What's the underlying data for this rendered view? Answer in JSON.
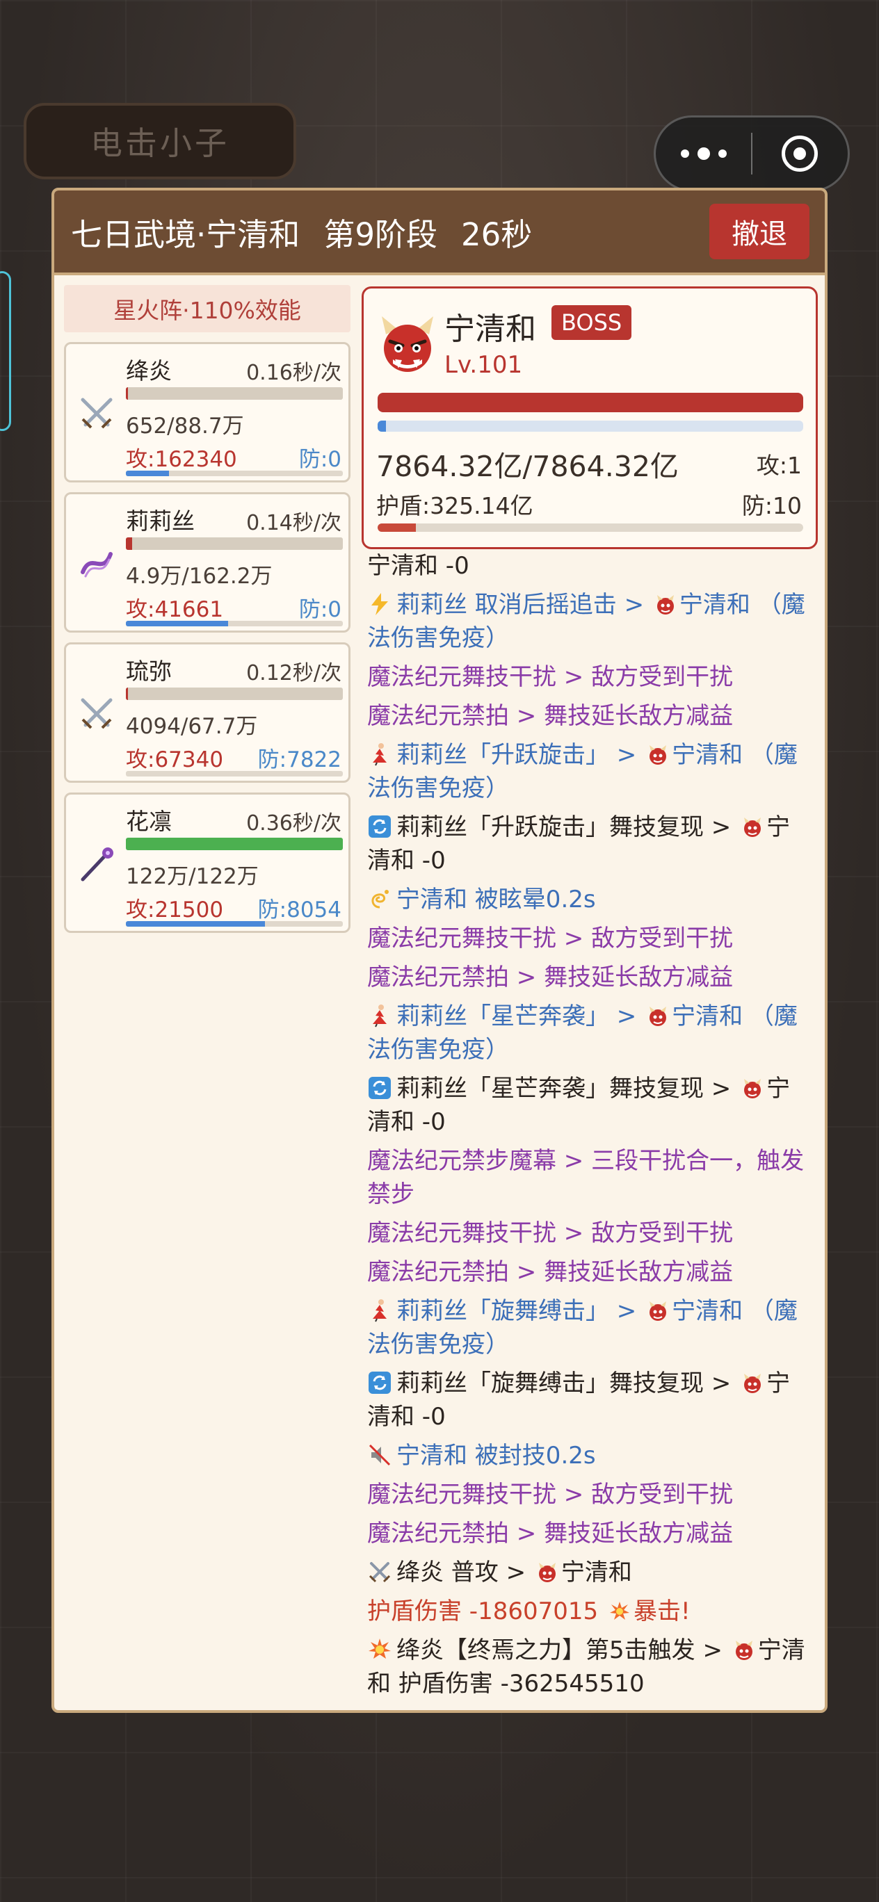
{
  "game": {
    "title": "电击小子"
  },
  "dialog": {
    "title_name": "七日武境·宁清和",
    "stage": "第9阶段",
    "timer": "26秒",
    "retreat_label": "撤退"
  },
  "formation": {
    "label": "星火阵·110%效能"
  },
  "heroes": [
    {
      "name": "绛炎",
      "speed": "0.16秒/次",
      "hp": "652/88.7万",
      "atk": "攻:162340",
      "def": "防:0",
      "hp_fraction": 0.01,
      "mp_fraction": 0.2,
      "icon": "crossed-swords-icon"
    },
    {
      "name": "莉莉丝",
      "speed": "0.14秒/次",
      "hp": "4.9万/162.2万",
      "atk": "攻:41661",
      "def": "防:0",
      "hp_fraction": 0.03,
      "mp_fraction": 0.47,
      "icon": "ribbon-icon"
    },
    {
      "name": "琉弥",
      "speed": "0.12秒/次",
      "hp": "4094/67.7万",
      "atk": "攻:67340",
      "def": "防:7822",
      "hp_fraction": 0.01,
      "mp_fraction": 0.0,
      "icon": "crossed-swords-icon"
    },
    {
      "name": "花凛",
      "speed": "0.36秒/次",
      "hp": "122万/122万",
      "atk": "攻:21500",
      "def": "防:8054",
      "hp_fraction": 1.0,
      "mp_fraction": 0.64,
      "icon": "staff-icon"
    }
  ],
  "boss": {
    "name": "宁清和",
    "tag": "BOSS",
    "level": "Lv.101",
    "hp": "7864.32亿/7864.32亿",
    "atk": "攻:1",
    "shield": "护盾:325.14亿",
    "def": "防:10",
    "hp_fraction": 1.0,
    "mp_fraction": 0.02,
    "shield_fraction": 0.09
  },
  "log": [
    {
      "color": "black",
      "text": "宁清和 -0"
    },
    {
      "color": "blue",
      "icon": "lightning-icon",
      "text": "莉莉丝 取消后摇追击 > ",
      "target": "宁清和 （魔法伤害免疫）"
    },
    {
      "color": "purple",
      "text": "魔法纪元舞技干扰 > 敌方受到干扰"
    },
    {
      "color": "purple",
      "text": "魔法纪元禁拍 > 舞技延长敌方减益"
    },
    {
      "color": "blue",
      "icon": "dancer-icon",
      "text": "莉莉丝「升跃旋击」 > ",
      "target": "宁清和 （魔法伤害免疫）"
    },
    {
      "color": "black",
      "icon": "repeat-icon",
      "text": "莉莉丝「升跃旋击」舞技复现 > ",
      "target": "宁清和 -0"
    },
    {
      "color": "blue",
      "icon": "dizzy-icon",
      "text": "宁清和 被眩晕0.2s"
    },
    {
      "color": "purple",
      "text": "魔法纪元舞技干扰 > 敌方受到干扰"
    },
    {
      "color": "purple",
      "text": "魔法纪元禁拍 > 舞技延长敌方减益"
    },
    {
      "color": "blue",
      "icon": "dancer-icon",
      "text": "莉莉丝「星芒奔袭」 > ",
      "target": "宁清和 （魔法伤害免疫）"
    },
    {
      "color": "black",
      "icon": "repeat-icon",
      "text": "莉莉丝「星芒奔袭」舞技复现 > ",
      "target": "宁清和 -0"
    },
    {
      "color": "purple",
      "text": "魔法纪元禁步魔幕 > 三段干扰合一，触发禁步"
    },
    {
      "color": "purple",
      "text": "魔法纪元舞技干扰 > 敌方受到干扰"
    },
    {
      "color": "purple",
      "text": "魔法纪元禁拍 > 舞技延长敌方减益"
    },
    {
      "color": "blue",
      "icon": "dancer-icon",
      "text": "莉莉丝「旋舞缚击」 > ",
      "target": "宁清和 （魔法伤害免疫）"
    },
    {
      "color": "black",
      "icon": "repeat-icon",
      "text": "莉莉丝「旋舞缚击」舞技复现 > ",
      "target": "宁清和 -0"
    },
    {
      "color": "blue",
      "icon": "mute-icon",
      "text": "宁清和 被封技0.2s"
    },
    {
      "color": "purple",
      "text": "魔法纪元舞技干扰 > 敌方受到干扰"
    },
    {
      "color": "purple",
      "text": "魔法纪元禁拍 > 舞技延长敌方减益"
    },
    {
      "color": "black",
      "icon": "crossed-swords-icon",
      "text": "绛炎 普攻 > ",
      "target": "宁清和"
    },
    {
      "color": "red",
      "text": "护盾伤害 -18607015 ",
      "tail": "暴击!"
    },
    {
      "color": "black",
      "icon": "explosion-icon",
      "text": "绛炎【终焉之力】第5击触发 > ",
      "target": "宁清和 护盾伤害 -362545510"
    }
  ]
}
